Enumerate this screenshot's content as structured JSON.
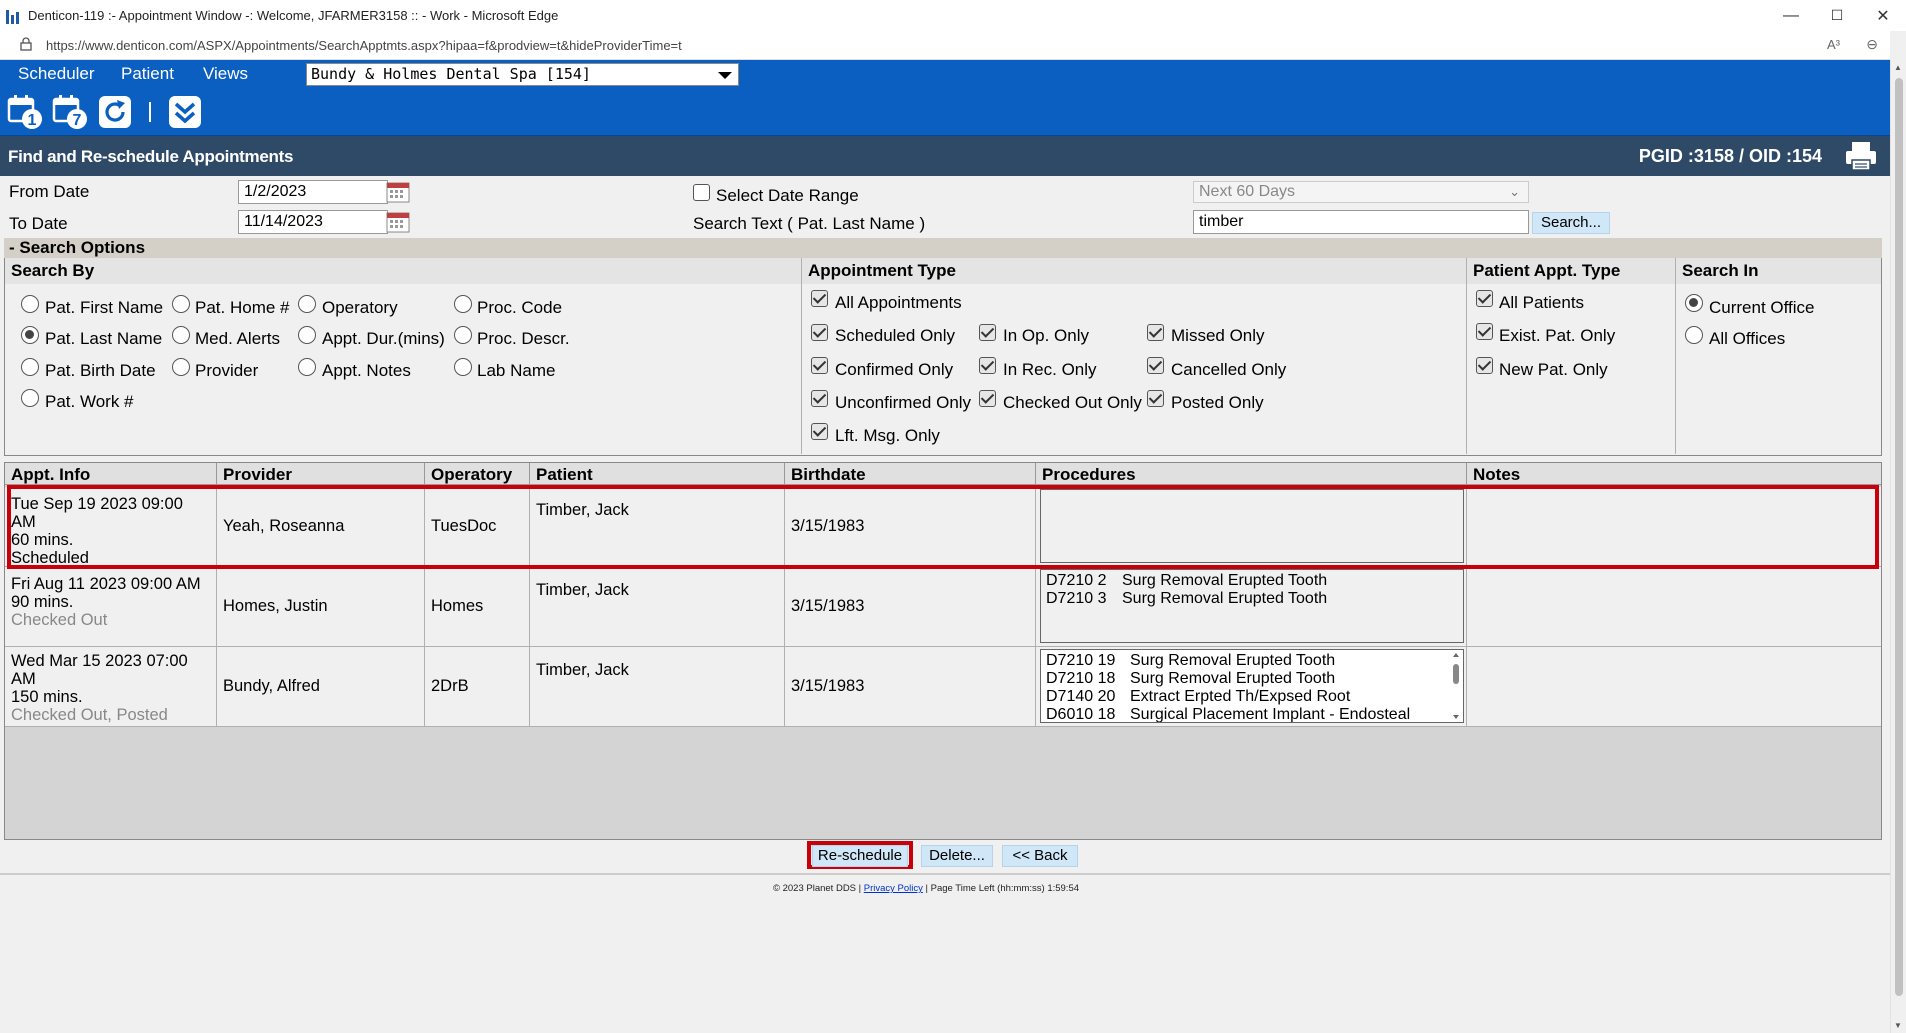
{
  "browser": {
    "title": "Denticon-119 :- Appointment Window -: Welcome, JFARMER3158 :: - Work - Microsoft Edge",
    "url": "https://www.denticon.com/ASPX/Appointments/SearchApptmts.aspx?hipaa=f&prodview=t&hideProviderTime=t",
    "minimize": "—",
    "maximize": "☐",
    "close": "✕",
    "read_aloud": "A³",
    "zoom": "⊖"
  },
  "nav": {
    "menus": [
      "Scheduler",
      "Patient",
      "Views"
    ],
    "office": "Bundy & Holmes Dental Spa [154]"
  },
  "toolbar": {
    "icons": [
      "day-calendar-icon",
      "week-calendar-icon",
      "refresh-icon",
      "collapse-chevron-icon"
    ],
    "day_num": "1",
    "week_num": "7"
  },
  "page": {
    "title": "Find and Re-schedule Appointments",
    "ids": "PGID :3158  /  OID :154"
  },
  "filters": {
    "from_date_label": "From Date",
    "from_date": "1/2/2023",
    "to_date_label": "To Date",
    "to_date": "11/14/2023",
    "select_date_range": "Select Date Range",
    "search_text_label": "Search Text ( Pat. Last Name )",
    "range": "Next 60 Days",
    "search_value": "timber",
    "search_button": "Search..."
  },
  "search_options": {
    "header": "- Search Options",
    "search_by": {
      "title": "Search By",
      "items": [
        "Pat. First Name",
        "Pat. Home #",
        "Operatory",
        "Proc. Code",
        "Pat. Last Name",
        "Med. Alerts",
        "Appt. Dur.(mins)",
        "Proc. Descr.",
        "Pat. Birth Date",
        "Provider",
        "Appt. Notes",
        "Lab Name",
        "Pat. Work #"
      ],
      "selected": "Pat. Last Name"
    },
    "appointment_type": {
      "title": "Appointment Type",
      "items": [
        "All Appointments",
        "Scheduled Only",
        "In Op. Only",
        "Missed Only",
        "Confirmed Only",
        "In Rec. Only",
        "Cancelled Only",
        "Unconfirmed Only",
        "Checked Out Only",
        "Posted Only",
        "Lft. Msg. Only"
      ]
    },
    "patient_appt_type": {
      "title": "Patient Appt. Type",
      "items": [
        "All Patients",
        "Exist. Pat. Only",
        "New Pat. Only"
      ]
    },
    "search_in": {
      "title": "Search In",
      "items": [
        "Current Office",
        "All Offices"
      ],
      "selected": "Current Office"
    }
  },
  "results": {
    "columns": [
      "Appt. Info",
      "Provider",
      "Operatory",
      "Patient",
      "Birthdate",
      "Procedures",
      "Notes"
    ],
    "rows": [
      {
        "date": "Tue Sep 19 2023 09:00 AM",
        "duration": "60 mins.",
        "status": "Scheduled",
        "provider": "Yeah, Roseanna",
        "operatory": "TuesDoc",
        "patient": "Timber, Jack",
        "birthdate": "3/15/1983",
        "procedures": [],
        "notes": ""
      },
      {
        "date": "Fri Aug 11 2023 09:00 AM",
        "duration": "90 mins.",
        "status": "Checked Out",
        "provider": "Homes, Justin",
        "operatory": "Homes",
        "patient": "Timber, Jack",
        "birthdate": "3/15/1983",
        "procedures": [
          {
            "code": "D7210 2",
            "desc": "Surg Removal Erupted Tooth"
          },
          {
            "code": "D7210 3",
            "desc": "Surg Removal Erupted Tooth"
          }
        ],
        "notes": ""
      },
      {
        "date": "Wed Mar 15 2023 07:00 AM",
        "duration": "150 mins.",
        "status": "Checked Out, Posted",
        "provider": "Bundy, Alfred",
        "operatory": "2DrB",
        "patient": "Timber, Jack",
        "birthdate": "3/15/1983",
        "procedures": [
          {
            "code": "D7210 19",
            "desc": "Surg Removal Erupted Tooth"
          },
          {
            "code": "D7210 18",
            "desc": "Surg Removal Erupted Tooth"
          },
          {
            "code": "D7140 20",
            "desc": "Extract Erpted Th/Expsed Root"
          },
          {
            "code": "D6010 18",
            "desc": "Surgical Placement Implant - Endosteal"
          }
        ],
        "notes": ""
      }
    ]
  },
  "actions": {
    "reschedule": "Re-schedule",
    "delete": "Delete...",
    "back": "<< Back"
  },
  "footer": {
    "copyright": "© 2023 Planet DDS | ",
    "privacy": "Privacy Policy",
    "page_time": " | Page Time Left (hh:mm:ss) 1:59:54"
  },
  "colors": {
    "brand_blue": "#0b5fc1",
    "header_navy": "#2f4a66",
    "highlight_red": "#c8000a",
    "button_blue": "#cfe7f7"
  }
}
